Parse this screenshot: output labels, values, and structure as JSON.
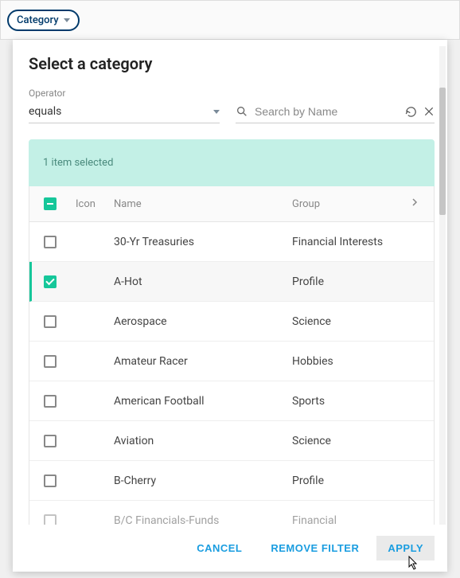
{
  "chip": {
    "label": "Category"
  },
  "modal": {
    "title": "Select a category",
    "operator": {
      "label": "Operator",
      "value": "equals"
    },
    "search": {
      "placeholder": "Search by Name"
    },
    "selection_banner": "1 item selected",
    "columns": {
      "icon": "Icon",
      "name": "Name",
      "group": "Group"
    },
    "rows": [
      {
        "name": "30-Yr Treasuries",
        "group": "Financial Interests",
        "checked": false
      },
      {
        "name": "A-Hot",
        "group": "Profile",
        "checked": true
      },
      {
        "name": "Aerospace",
        "group": "Science",
        "checked": false
      },
      {
        "name": "Amateur Racer",
        "group": "Hobbies",
        "checked": false
      },
      {
        "name": "American Football",
        "group": "Sports",
        "checked": false
      },
      {
        "name": "Aviation",
        "group": "Science",
        "checked": false
      },
      {
        "name": "B-Cherry",
        "group": "Profile",
        "checked": false
      },
      {
        "name": "B/C Financials-Funds",
        "group": "Financial",
        "checked": false
      }
    ],
    "footer": {
      "cancel": "Cancel",
      "remove": "Remove Filter",
      "apply": "Apply"
    }
  }
}
